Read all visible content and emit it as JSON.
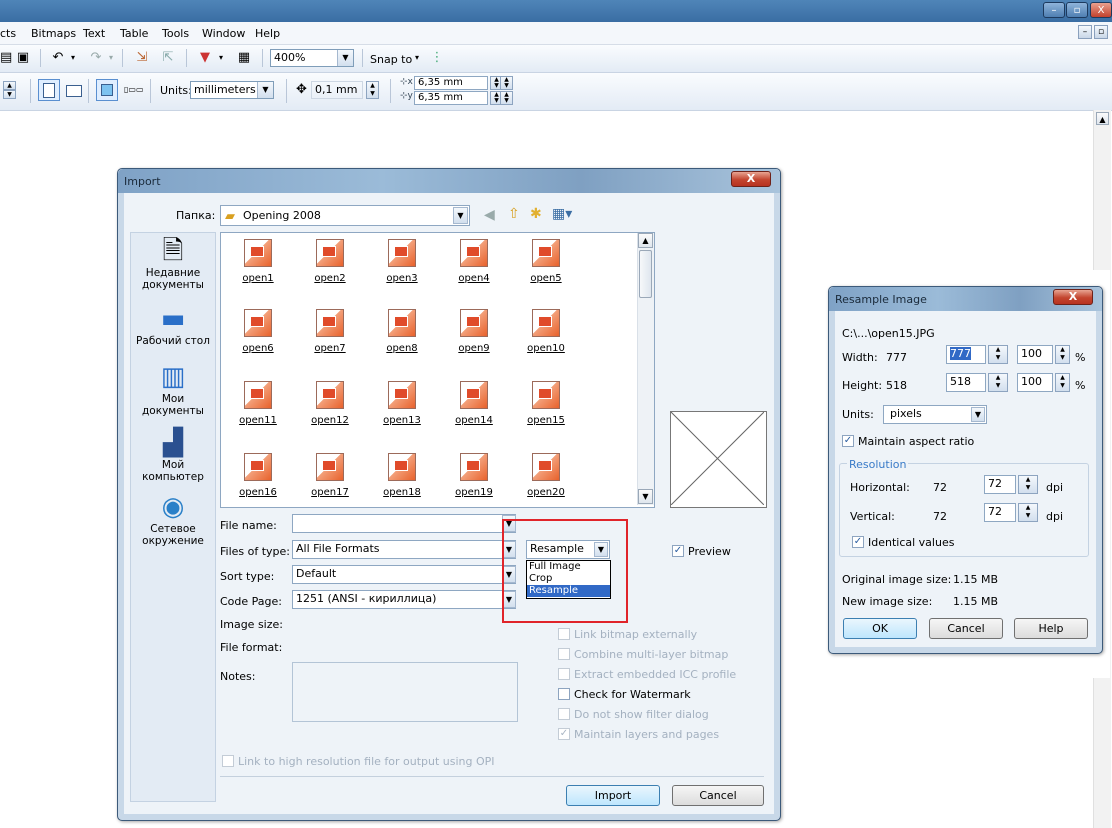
{
  "window": {
    "minimize_icon": "–",
    "restore_icon": "▫",
    "close_icon": "X"
  },
  "menu": {
    "items": [
      "cts",
      "Bitmaps",
      "Text",
      "Table",
      "Tools",
      "Window",
      "Help"
    ]
  },
  "mdi": {
    "min": "–",
    "restore": "▫"
  },
  "toolbar1": {
    "zoom": "400%",
    "snap_to": "Snap to"
  },
  "toolbar2": {
    "units_label": "Units:",
    "units_value": "millimeters",
    "nudge": "0,1 mm",
    "dup_x": "6,35 mm",
    "dup_y": "6,35 mm"
  },
  "import": {
    "title": "Import",
    "folder_label": "Папка:",
    "folder_value": "Opening 2008",
    "places": [
      "Недавние документы",
      "Рабочий стол",
      "Мои документы",
      "Мой компьютер",
      "Сетевое окружение"
    ],
    "files": [
      "open1",
      "open2",
      "open3",
      "open4",
      "open5",
      "open6",
      "open7",
      "open8",
      "open9",
      "open10",
      "open11",
      "open12",
      "open13",
      "open14",
      "open15",
      "open16",
      "open17",
      "open18",
      "open19",
      "open20"
    ],
    "file_name_label": "File name:",
    "file_name_value": "",
    "files_of_type_label": "Files of type:",
    "files_of_type_value": "All File Formats",
    "sort_type_label": "Sort type:",
    "sort_type_value": "Default",
    "code_page_label": "Code Page:",
    "code_page_value": "1251  (ANSI - кириллица)",
    "image_size_label": "Image size:",
    "file_format_label": "File format:",
    "notes_label": "Notes:",
    "mode_value": "Resample",
    "mode_options": [
      "Full Image",
      "Crop",
      "Resample"
    ],
    "preview_label": "Preview",
    "options": [
      {
        "label": "Link bitmap externally",
        "checked": false,
        "enabled": false
      },
      {
        "label": "Combine multi-layer bitmap",
        "checked": false,
        "enabled": false
      },
      {
        "label": "Extract embedded ICC profile",
        "checked": false,
        "enabled": false
      },
      {
        "label": "Check for Watermark",
        "checked": false,
        "enabled": true
      },
      {
        "label": "Do not show filter dialog",
        "checked": false,
        "enabled": false
      },
      {
        "label": "Maintain layers and pages",
        "checked": true,
        "enabled": false
      }
    ],
    "opi_label": "Link to high resolution file for output using OPI",
    "import_button": "Import",
    "cancel_button": "Cancel",
    "close_icon": "X"
  },
  "resample": {
    "title": "Resample Image",
    "path": "C:\\...\\open15.JPG",
    "width_label": "Width:",
    "width_orig": "777",
    "width_value": "777",
    "width_pct": "100",
    "height_label": "Height:",
    "height_orig": "518",
    "height_value": "518",
    "height_pct": "100",
    "pct_sign": "%",
    "units_label": "Units:",
    "units_value": "pixels",
    "maintain_aspect": "Maintain aspect ratio",
    "resolution_label": "Resolution",
    "horizontal_label": "Horizontal:",
    "horizontal_orig": "72",
    "horizontal_value": "72",
    "vertical_label": "Vertical:",
    "vertical_orig": "72",
    "vertical_value": "72",
    "dpi": "dpi",
    "identical_values": "Identical values",
    "orig_size_label": "Original image size:",
    "orig_size_value": "1.15 MB",
    "new_size_label": "New image size:",
    "new_size_value": "1.15 MB",
    "ok_button": "OK",
    "cancel_button": "Cancel",
    "help_button": "Help",
    "close_icon": "X"
  },
  "colors": {
    "highlight": "#e0242a",
    "selection": "#3169c6",
    "titlebar": "#3a6da3"
  }
}
